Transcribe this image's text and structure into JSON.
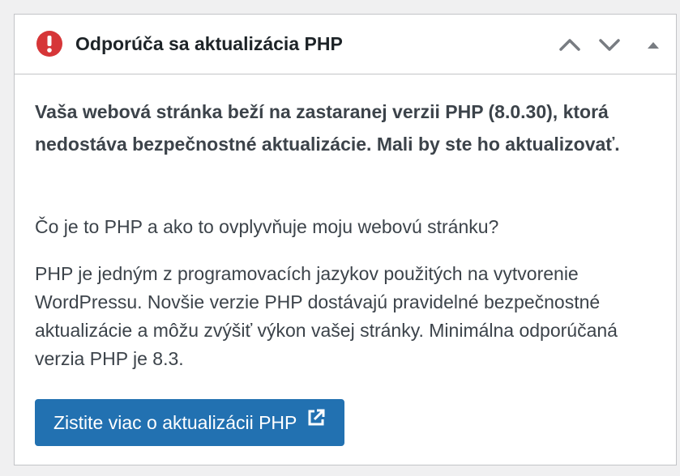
{
  "widget": {
    "title": "Odporúča sa aktualizácia PHP",
    "icons": {
      "alert": "exclamation-circle-icon",
      "move_up": "chevron-up-icon",
      "move_down": "chevron-down-icon",
      "toggle": "triangle-up-icon",
      "external": "external-link-icon"
    },
    "colors": {
      "alert": "#d63638",
      "button": "#2271b1",
      "text": "#3c434a",
      "title": "#1d2327",
      "controls": "#787c82"
    }
  },
  "body": {
    "intro": "Vaša webová stránka beží na zastaranej verzii PHP (8.0.30), ktorá nedostáva bezpečnostné aktualizácie. Mali by ste ho aktualizovať.",
    "question": "Čo je to PHP a ako to ovplyvňuje moju webovú stránku?",
    "explanation": "PHP je jedným z programovacích jazykov použitých na vytvorenie WordPressu. Novšie verzie PHP dostávajú pravidelné bezpečnostné aktualizácie a môžu zvýšiť výkon vašej stránky. Minimálna odporúčaná verzia PHP je 8.3.",
    "button_label": "Zistite viac o aktualizácii PHP"
  }
}
